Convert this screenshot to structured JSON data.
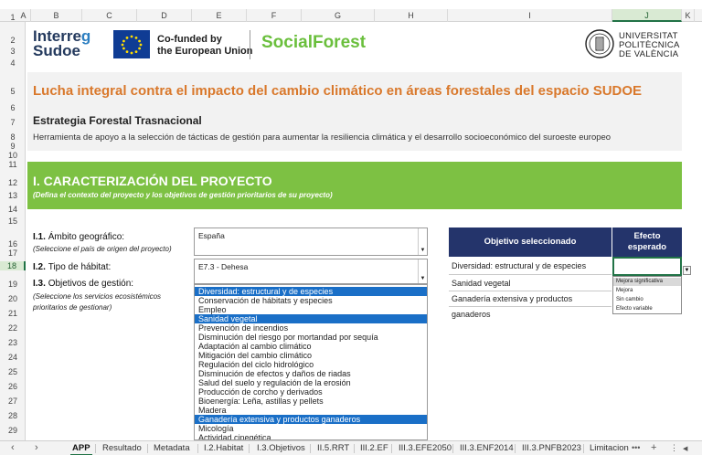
{
  "columns": [
    "A",
    "B",
    "C",
    "D",
    "E",
    "F",
    "G",
    "H",
    "I",
    "J",
    "K"
  ],
  "rows": [
    "1",
    "2",
    "3",
    "4",
    "5",
    "6",
    "7",
    "8",
    "9",
    "10",
    "11",
    "12",
    "13",
    "14",
    "15",
    "16",
    "17",
    "18",
    "19",
    "20",
    "21",
    "22",
    "23",
    "24",
    "25",
    "26",
    "27",
    "28",
    "29"
  ],
  "header": {
    "interreg_line1a": "Interre",
    "interreg_line1b": "g",
    "interreg_line2": "Sudoe",
    "cofund_line1": "Co-funded by",
    "cofund_line2": "the European Union",
    "brand": "SocialForest",
    "upv_line1": "UNIVERSITAT",
    "upv_line2": "POLITÈCNICA",
    "upv_line3": "DE VALÈNCIA"
  },
  "title": "Lucha integral contra el impacto del cambio climático en áreas forestales del espacio SUDOE",
  "strategy": "Estrategia Forestal Trasnacional",
  "description": "Herramienta de apoyo a la selección de tácticas de gestión para aumentar la resiliencia climática y el desarrollo socioeconómico del suroeste europeo",
  "section": {
    "title": "I. CARACTERIZACIÓN DEL PROYECTO",
    "subtitle": "(Defina el contexto del proyecto y los objetivos de gestión prioritarios de su proyecto)"
  },
  "form": {
    "ambito_num": "I.1.",
    "ambito_label": "Ámbito geográfico:",
    "ambito_hint": "(Seleccione el país de origen del proyecto)",
    "ambito_value": "España",
    "habitat_num": "I.2.",
    "habitat_label": "Tipo de hábitat:",
    "habitat_value": "E7.3 - Dehesa",
    "objetivos_num": "I.3.",
    "objetivos_label": "Objetivos de gestión:",
    "objetivos_hint1": "(Seleccione los servicios ecosistémicos",
    "objetivos_hint2": "prioritarios de gestionar)"
  },
  "objectives_list": [
    "Diversidad: estructural y de especies",
    "Conservación de hábitats y especies",
    "Empleo",
    "Sanidad vegetal",
    "Prevención de incendios",
    "Disminución del riesgo por mortandad por sequía",
    "Adaptación al cambio climático",
    "Mitigación del cambio climático",
    "Regulación del ciclo hidrológico",
    "Disminución de efectos y daños de riadas",
    "Salud del suelo y regulación de la erosión",
    "Producción de corcho y derivados",
    "Bioenergía: Leña, astillas y pellets",
    "Madera",
    "Ganadería extensiva y productos ganaderos",
    "Micología",
    "Actividad cinegética"
  ],
  "selected_indices": [
    0,
    3,
    14
  ],
  "table": {
    "header_objetivo": "Objetivo seleccionado",
    "header_efecto_line1": "Efecto",
    "header_efecto_line2": "esperado",
    "rows": [
      "Diversidad: estructural y de especies",
      "Sanidad vegetal",
      "Ganadería extensiva y productos ganaderos"
    ]
  },
  "effect_options": [
    "Mejora significativa",
    "Mejora",
    "Sin cambio",
    "Efecto variable"
  ],
  "tabs": [
    "APP",
    "Resultado",
    "Metadata",
    "I.2.Habitat",
    "I.3.Objetivos",
    "II.5.RRT",
    "III.2.EF",
    "III.3.EFE2050",
    "III.3.ENF2014",
    "III.3.PNFB2023",
    "Limitacion"
  ],
  "colors": {
    "accent_orange": "#d9782b",
    "accent_green": "#7dc143",
    "table_navy": "#24346b",
    "selection_blue": "#1a6fc7",
    "excel_green": "#217346"
  }
}
